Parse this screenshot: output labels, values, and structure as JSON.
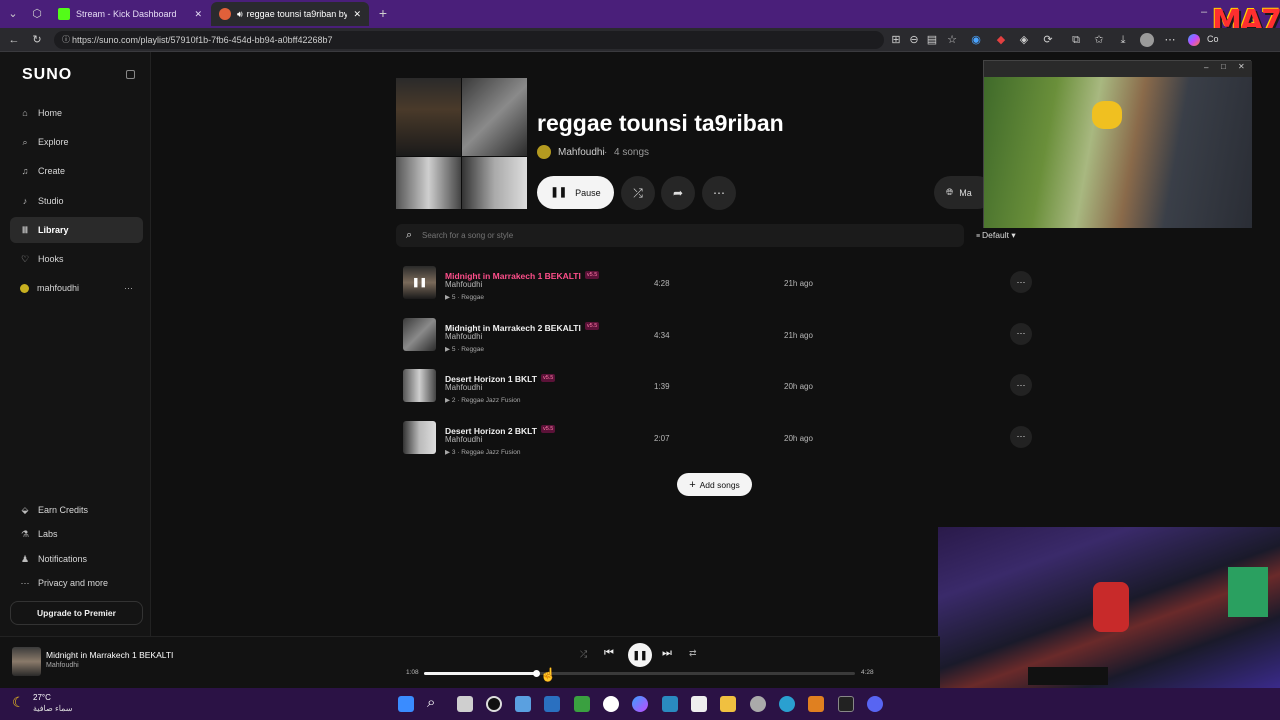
{
  "browser": {
    "tabs": [
      {
        "label": "Stream - Kick Dashboard"
      },
      {
        "label": "reggae tounsi ta9riban by @m"
      }
    ],
    "url": "https://suno.com/playlist/57910f1b-7fb6-454d-bb94-a0bff42268b7",
    "profile_label": "Co"
  },
  "overlay_logo": "MA7",
  "sidebar": {
    "logo": "SUNO",
    "items": [
      {
        "label": "Home",
        "icon": "home-icon"
      },
      {
        "label": "Explore",
        "icon": "search-icon"
      },
      {
        "label": "Create",
        "icon": "music-note-icon"
      },
      {
        "label": "Studio",
        "icon": "studio-icon"
      },
      {
        "label": "Library",
        "icon": "library-icon"
      },
      {
        "label": "Hooks",
        "icon": "hook-icon"
      },
      {
        "label": "mahfoudhi",
        "icon": "avatar"
      }
    ],
    "bottom_items": [
      {
        "label": "Earn Credits"
      },
      {
        "label": "Labs"
      },
      {
        "label": "Notifications"
      },
      {
        "label": "Privacy and more"
      }
    ],
    "upgrade_label": "Upgrade to Premier"
  },
  "playlist": {
    "title": "reggae tounsi ta9riban",
    "owner": "Mahfoudhi",
    "song_count": "4 songs",
    "pause_label": "Pause",
    "make_label": "Ma",
    "search_placeholder": "Search for a song or style",
    "sort_label": "Default",
    "add_songs_label": "Add songs",
    "songs": [
      {
        "title": "Midnight in Marrakech 1 BEKALTI",
        "version": "v5.5",
        "artist": "Mahfoudhi",
        "plays": "5",
        "style": "Reggae",
        "duration": "4:28",
        "age": "21h ago"
      },
      {
        "title": "Midnight in Marrakech 2 BEKALTI",
        "version": "v5.5",
        "artist": "Mahfoudhi",
        "plays": "5",
        "style": "Reggae",
        "duration": "4:34",
        "age": "21h ago"
      },
      {
        "title": "Desert Horizon 1 BKLT",
        "version": "v5.5",
        "artist": "Mahfoudhi",
        "plays": "2",
        "style": "Reggae Jazz Fusion",
        "duration": "1:39",
        "age": "20h ago"
      },
      {
        "title": "Desert Horizon 2 BKLT",
        "version": "v5.5",
        "artist": "Mahfoudhi",
        "plays": "3",
        "style": "Reggae Jazz Fusion",
        "duration": "2:07",
        "age": "20h ago"
      }
    ]
  },
  "player": {
    "title": "Midnight in Marrakech 1 BEKALTI",
    "artist": "Mahfoudhi",
    "elapsed": "1:08",
    "total": "4:28",
    "progress": 0.26
  },
  "taskbar": {
    "temperature": "27°C",
    "weather": "سماء صافية"
  },
  "colors": {
    "accent_pink": "#ff4f8b",
    "browser_purple": "#4a1f7a",
    "taskbar_purple": "#2b1245"
  }
}
